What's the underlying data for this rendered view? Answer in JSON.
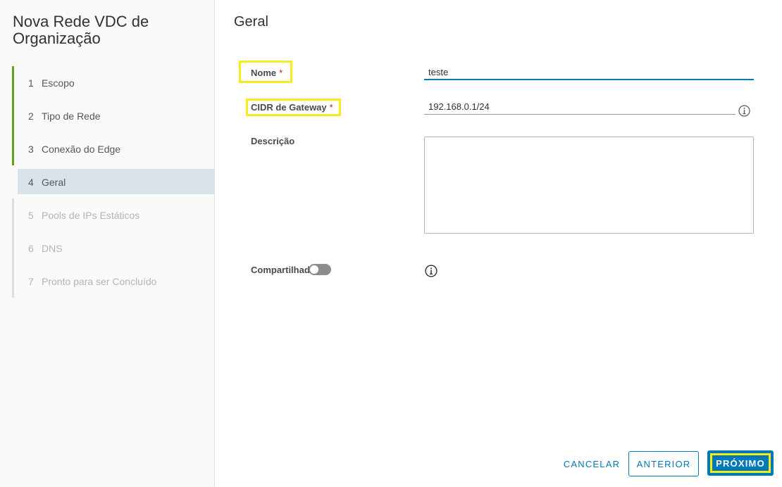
{
  "wizard": {
    "title": "Nova Rede VDC de Organização",
    "steps": [
      {
        "num": "1",
        "label": "Escopo",
        "state": "complete"
      },
      {
        "num": "2",
        "label": "Tipo de Rede",
        "state": "complete"
      },
      {
        "num": "3",
        "label": "Conexão do Edge",
        "state": "complete"
      },
      {
        "num": "4",
        "label": "Geral",
        "state": "current"
      },
      {
        "num": "5",
        "label": "Pools de IPs Estáticos",
        "state": "disabled"
      },
      {
        "num": "6",
        "label": "DNS",
        "state": "disabled"
      },
      {
        "num": "7",
        "label": "Pronto para ser Concluído",
        "state": "disabled"
      }
    ]
  },
  "page": {
    "title": "Geral"
  },
  "form": {
    "name": {
      "label": "Nome",
      "required_mark": "*",
      "value": "teste"
    },
    "gateway_cidr": {
      "label": "CIDR de Gateway",
      "required_mark": "*",
      "value": "192.168.0.1/24"
    },
    "description": {
      "label": "Descrição",
      "value": ""
    },
    "shared": {
      "label": "Compartilhado",
      "enabled": false
    }
  },
  "footer": {
    "cancel_label": "CANCELAR",
    "previous_label": "ANTERIOR",
    "next_label": "PRÓXIMO"
  },
  "colors": {
    "accent": "#0079b8",
    "step_complete": "#62a420",
    "current_step_bg": "#d8e3e9",
    "highlight": "#f5ec1a"
  },
  "icons": {
    "gateway_help": "info-icon",
    "shared_help": "info-icon"
  }
}
